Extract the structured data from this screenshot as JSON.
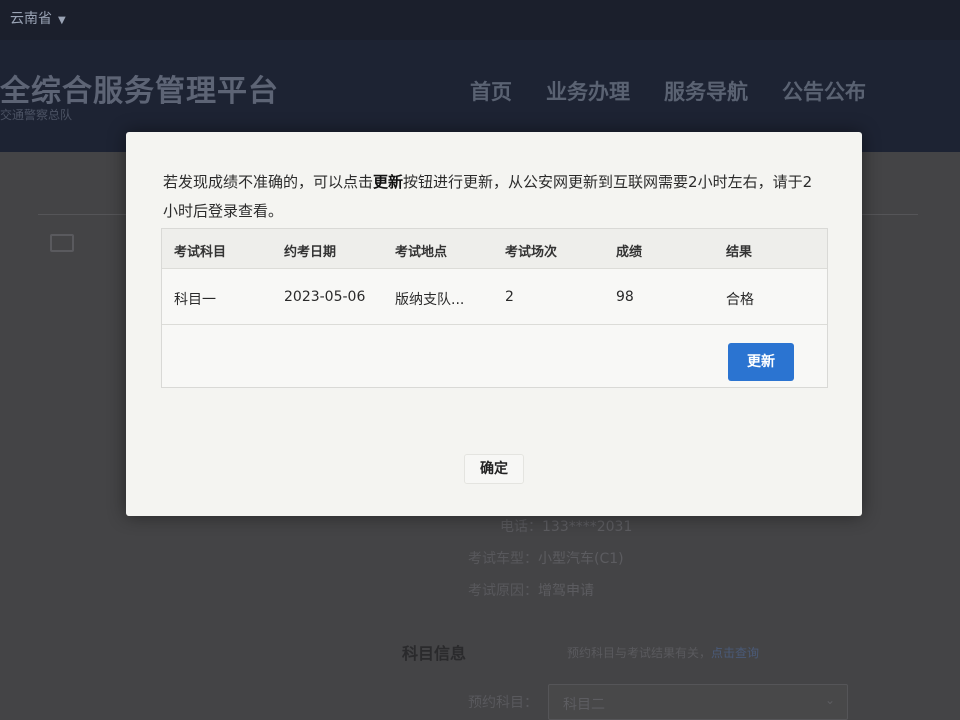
{
  "topbar": {
    "region": "云南省",
    "caret": "▼"
  },
  "header": {
    "title": "全综合服务管理平台",
    "subtitle": "交通警察总队",
    "nav": [
      "首页",
      "业务办理",
      "服务导航",
      "公告公布"
    ]
  },
  "background": {
    "phone_label": "电话：",
    "phone_value": "133****2031",
    "vehicle_label": "考试车型：",
    "vehicle_value": "小型汽车(C1)",
    "reason_label": "考试原因：",
    "reason_value": "增驾申请",
    "section_title": "科目信息",
    "section_hint": "预约科目与考试结果有关，",
    "section_link": "点击查询",
    "select_label": "预约科目：",
    "select_value": "科目二"
  },
  "modal": {
    "notice_part1": "若发现成绩不准确的，可以点击",
    "notice_bold": "更新",
    "notice_part2": "按钮进行更新，从公安网更新到互联网需要2小时左右，请于2小时后登录查看。",
    "columns": [
      "考试科目",
      "约考日期",
      "考试地点",
      "考试场次",
      "成绩",
      "结果"
    ],
    "row": [
      "科目一",
      "2023-05-06",
      "版纳支队...",
      "2",
      "98",
      "合格"
    ],
    "update_button": "更新",
    "confirm_button": "确定"
  }
}
